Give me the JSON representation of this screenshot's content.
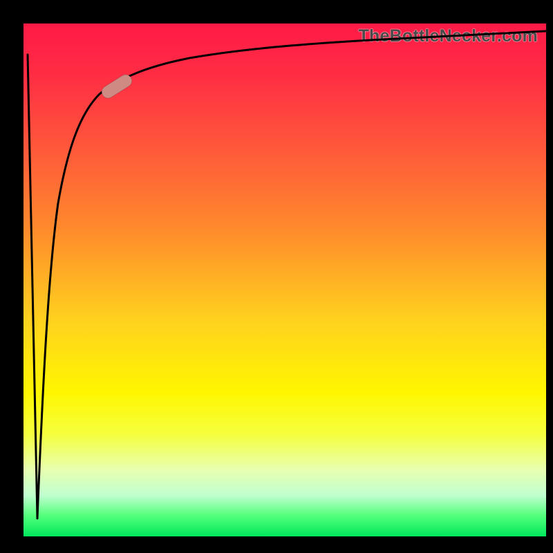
{
  "branding": {
    "text": "TheBottleNecker.com"
  },
  "colors": {
    "background": "#000000",
    "gradient_top": "#ff1a46",
    "gradient_mid": "#fff600",
    "gradient_bottom": "#00e85c",
    "curve": "#000000",
    "marker": "#cf8a84"
  },
  "chart_data": {
    "type": "line",
    "title": "",
    "xlabel": "",
    "ylabel": "",
    "xlim": [
      0,
      100
    ],
    "ylim": [
      0,
      100
    ],
    "grid": false,
    "legend": false,
    "series": [
      {
        "name": "bottleneck-curve",
        "x": [
          0,
          2,
          3,
          4,
          5,
          6,
          7,
          8,
          9,
          10,
          12,
          15,
          18,
          22,
          28,
          35,
          45,
          60,
          80,
          100
        ],
        "values": [
          93,
          0,
          30,
          50,
          62,
          70,
          76,
          80,
          83,
          85,
          87,
          89,
          90,
          91,
          92,
          93,
          94,
          94.5,
          95,
          95.5
        ]
      }
    ],
    "annotations": [
      {
        "name": "marker-pill",
        "x": 15,
        "y": 87,
        "angle_deg": 35
      }
    ]
  }
}
